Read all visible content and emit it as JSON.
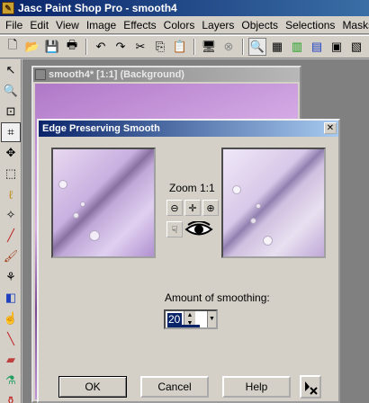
{
  "app": {
    "title": "Jasc Paint Shop Pro - smooth4"
  },
  "menu": [
    "File",
    "Edit",
    "View",
    "Image",
    "Effects",
    "Colors",
    "Layers",
    "Objects",
    "Selections",
    "Masks"
  ],
  "image_window": {
    "title": "smooth4* [1:1] (Background)"
  },
  "dialog": {
    "title": "Edge Preserving Smooth",
    "close_label": "✕",
    "zoom_label": "Zoom 1:1",
    "amount_label": "Amount of smoothing:",
    "amount_value": "20",
    "ok_label": "OK",
    "cancel_label": "Cancel",
    "help_label": "Help"
  },
  "colors": {
    "title_bar": "#0a246a",
    "chrome": "#d4d0c8"
  }
}
